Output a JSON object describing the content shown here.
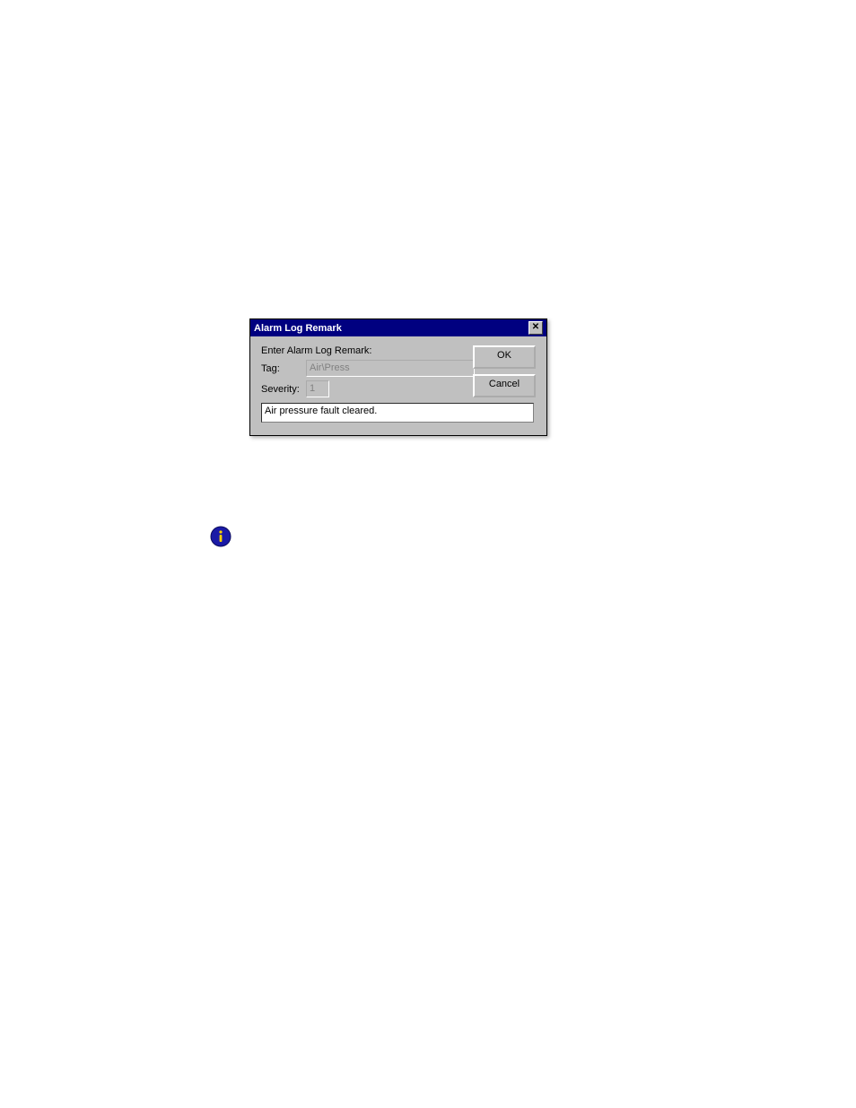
{
  "dialog": {
    "title": "Alarm Log Remark",
    "prompt": "Enter Alarm Log Remark:",
    "tag_label": "Tag:",
    "tag_value": "Air\\Press",
    "severity_label": "Severity:",
    "severity_value": "1",
    "remark_value": "Air pressure fault cleared.",
    "ok_label": "OK",
    "cancel_label": "Cancel",
    "close_glyph": "✕"
  }
}
